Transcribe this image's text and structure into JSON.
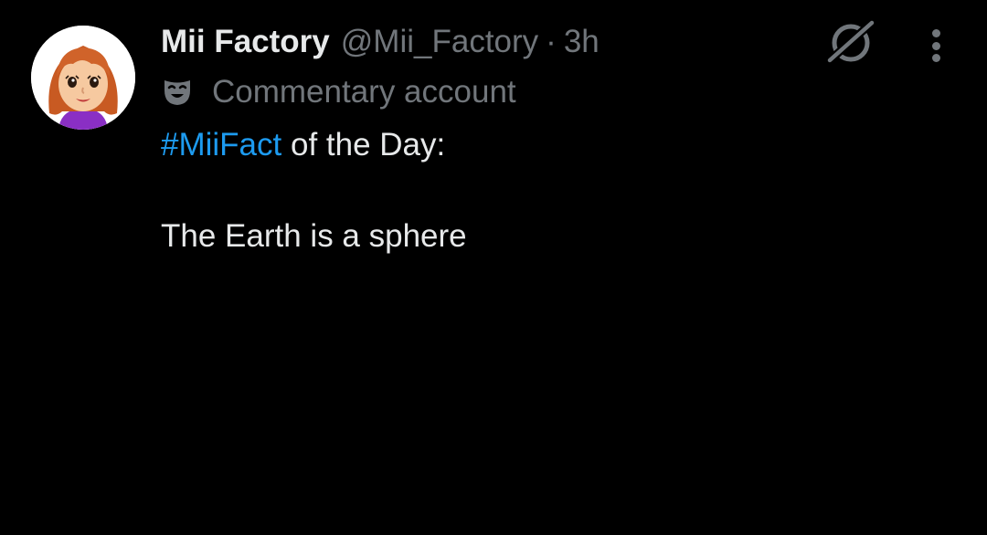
{
  "tweet": {
    "display_name": "Mii Factory",
    "handle": "@Mii_Factory",
    "separator": "·",
    "time": "3h",
    "account_label": "Commentary account",
    "hashtag": "#MiiFact",
    "line1_rest": " of the Day:",
    "line2": "The Earth is a sphere"
  },
  "icons": {
    "avatar": "mii-avatar",
    "label": "theater-mask-icon",
    "grok": "grok-icon",
    "more": "more-vertical-icon"
  },
  "colors": {
    "background": "#000000",
    "primary_text": "#e7e9ea",
    "secondary_text": "#71767b",
    "link": "#1d9bf0"
  }
}
